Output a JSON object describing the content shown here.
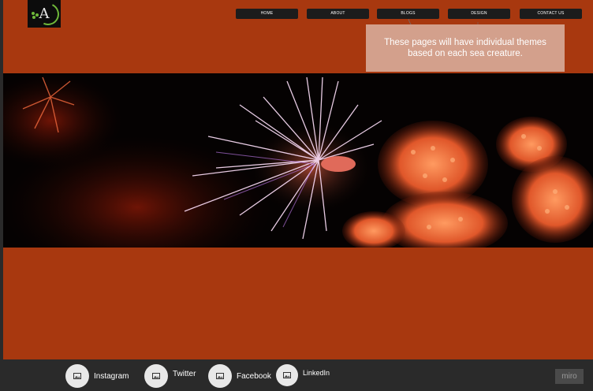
{
  "nav": {
    "items": [
      "HOME",
      "ABOUT",
      "BLOGS",
      "DESIGN",
      "CONTACT US"
    ]
  },
  "logo": {
    "letter": "A"
  },
  "annotation": {
    "text": "These pages will have individual themes based on each sea creature."
  },
  "footer": {
    "socials": [
      {
        "label": "Instagram",
        "icon": "image-icon"
      },
      {
        "label": "Twitter",
        "icon": "image-icon"
      },
      {
        "label": "Facebook",
        "icon": "image-icon"
      },
      {
        "label": "LinkedIn",
        "icon": "image-icon"
      }
    ]
  },
  "watermark": {
    "text": "miro"
  },
  "colors": {
    "page_background": "#a8380f",
    "nav_button": "#1c1c1c",
    "annotation_box": "#d3a08c",
    "footer": "#2a2a2a",
    "logo_accent": "#6fb83a"
  }
}
